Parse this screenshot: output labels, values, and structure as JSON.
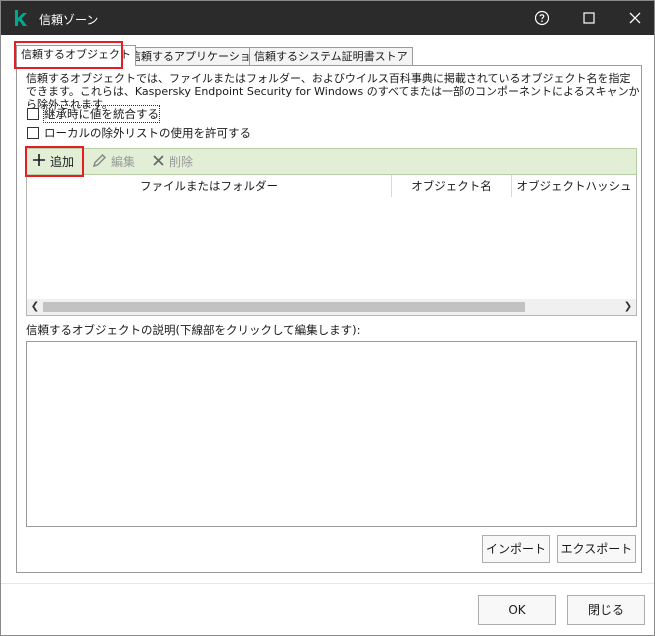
{
  "window": {
    "title": "信頼ゾーン",
    "accent_color": "#00a88e",
    "controls": [
      "help-icon",
      "maximize-icon",
      "close-icon"
    ]
  },
  "tabs": [
    {
      "label": "信頼するオブジェクト",
      "active": true
    },
    {
      "label": "信頼するアプリケーション",
      "active": false
    },
    {
      "label": "信頼するシステム証明書ストア",
      "active": false
    }
  ],
  "description": "信頼するオブジェクトでは、ファイルまたはフォルダー、およびウイルス百科事典に掲載されているオブジェクト名を指定できます。これらは、Kaspersky Endpoint Security for Windows のすべてまたは一部のコンポーネントによるスキャンから除外されます。",
  "checkboxes": [
    {
      "label": "継承時に値を統合する",
      "checked": false
    },
    {
      "label": "ローカルの除外リストの使用を許可する",
      "checked": false
    }
  ],
  "toolbar": {
    "add_label": "追加",
    "edit_label": "編集",
    "delete_label": "削除"
  },
  "table": {
    "columns": [
      "ファイルまたはフォルダー",
      "オブジェクト名",
      "オブジェクトハッシュ"
    ],
    "rows": []
  },
  "object_description_label": "信頼するオブジェクトの説明(下線部をクリックして編集します):",
  "buttons": {
    "import_label": "インポート",
    "export_label": "エクスポート",
    "ok_label": "OK",
    "close_label": "閉じる"
  }
}
